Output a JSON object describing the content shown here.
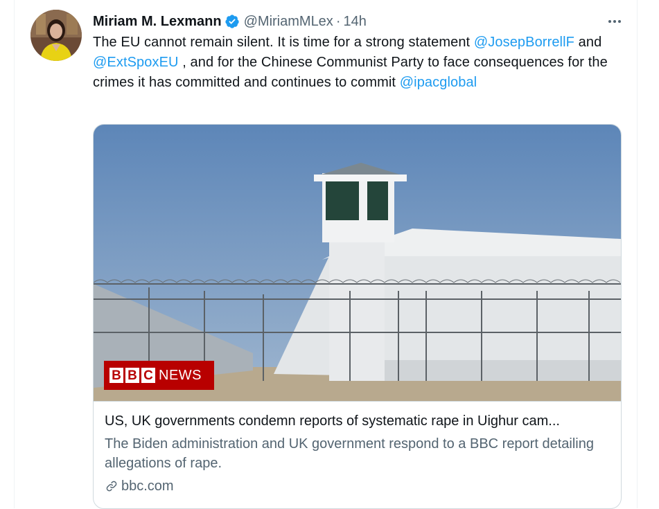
{
  "tweet": {
    "author_name": "Miriam M. Lexmann",
    "handle": "@MiriamMLex",
    "separator": "·",
    "time": "14h",
    "text_parts": {
      "t1": "The EU cannot remain silent. It is time for a strong statement ",
      "m1": "@JosepBorrellF",
      "t2": " and ",
      "m2": "@ExtSpoxEU",
      "t3": " , and for the Chinese Communist Party to face consequences for the crimes it has committed and continues to commit ",
      "m3": "@ipacglobal"
    },
    "icons": {
      "verified": "verified-badge-icon",
      "more": "more-options-icon",
      "link": "link-icon"
    },
    "colors": {
      "link": "#1d9bf0",
      "secondary_text": "#536471",
      "bbc_red": "#b80000"
    }
  },
  "card": {
    "image_badge": {
      "letters": [
        "B",
        "B",
        "C"
      ],
      "word": "NEWS"
    },
    "title": "US, UK governments condemn reports of systematic rape in Uighur cam...",
    "description": "The Biden administration and UK government respond to a BBC report detailing allegations of rape.",
    "domain": "bbc.com"
  }
}
